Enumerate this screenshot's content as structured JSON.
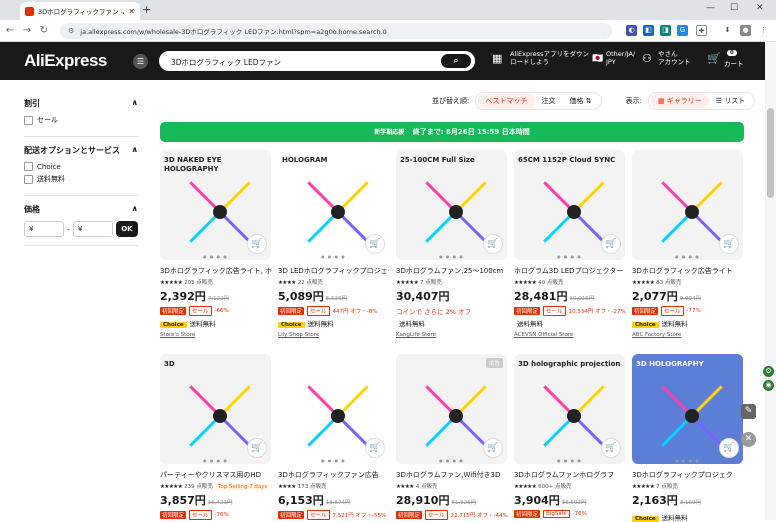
{
  "browser": {
    "tab_title": "3Dホログラフィックファン -AliEx",
    "url": "ja.aliexpress.com/w/wholesale-3Dホログラフィック LEDファン.html?spm=a2g0o.home.search.0"
  },
  "header": {
    "logo": "AliExpress",
    "search_value": "3Dホログラフィック LEDファン",
    "app_line1": "AliExpressアプリをダウン",
    "app_line2": "ロードしよう",
    "lang_line1": "Other/JA/",
    "lang_line2": "JPY",
    "account_line1": "やさん",
    "account_line2": "アカウント",
    "cart_label": "カート",
    "cart_count": "0"
  },
  "sidebar": {
    "discount_title": "割引",
    "sale_label": "セール",
    "delivery_title": "配送オプションとサービス",
    "choice_label": "Choice",
    "free_shipping_label": "送料無料",
    "price_title": "価格",
    "min_placeholder": "¥",
    "max_placeholder": "¥",
    "ok_label": "OK"
  },
  "sortbar": {
    "label": "並び替え順:",
    "options": [
      "ベストマッチ",
      "注文",
      "価格"
    ],
    "view_label": "表示:",
    "gallery": "ギャラリー",
    "list": "リスト"
  },
  "banner": {
    "tag": "新学期応援",
    "text": "終了まで: 8月26日 15:59 日本時間"
  },
  "products": [
    {
      "title": "3Dホログラフィック広告ライト, ホログラフ",
      "stars": "★★★★★",
      "rating_text": "205 点販売",
      "price": "2,392円",
      "old": "7,122円",
      "badge": "初回限定",
      "sale": "セール",
      "extra": "-66%",
      "choice": "Choice",
      "ship": "送料無料",
      "store": "Store's Store",
      "img_text": "3D NAKED EYE HOLOGRAPHY",
      "img_kind": "white",
      "color": "#ffffff"
    },
    {
      "title": "3D LEDホログラフィックプロジェクター",
      "stars": "★★★★",
      "rating_text": "22 点販売",
      "price": "5,089円",
      "old": "5,536円",
      "badge": "初回限定",
      "sale": "セール",
      "extra": "447円 オフ・-8%",
      "choice": "Choice",
      "ship": "送料無料",
      "store": "Lily Shop Store",
      "img_text": "HOLOGRAM",
      "img_kind": "dark",
      "color": "#ffffff"
    },
    {
      "title": "3Dホログラムファン,25〜100cm",
      "stars": "★★★★★",
      "rating_text": "7 点販売",
      "price": "30,407円",
      "old": "",
      "badge": "",
      "sale": "",
      "extra": "コインで さらに 2% オフ",
      "choice": "",
      "ship": "送料無料",
      "store": "KangLife Store",
      "img_text": "25-100CM Full Size",
      "img_kind": "white",
      "color": "#ffffff"
    },
    {
      "title": "ホログラム3D LEDプロジェクター",
      "stars": "★★★★★",
      "rating_text": "40 点販売",
      "price": "28,481円",
      "old": "39,015円",
      "badge": "初回限定",
      "sale": "セール",
      "extra": "10,534円 オフ・-27%",
      "choice": "",
      "ship": "送料無料",
      "store": "ACEVSN Official Store",
      "img_text": "65CM 1152P Cloud SYNC",
      "img_kind": "white",
      "color": "#ffffff"
    },
    {
      "title": "3Dホログラフィック広告ライト",
      "stars": "★★★★★",
      "rating_text": "83 点販売",
      "price": "2,077円",
      "old": "9,094円",
      "badge": "初回限定",
      "sale": "セール",
      "extra": "-77%",
      "choice": "Choice",
      "ship": "送料無料",
      "store": "ABC Factory Store",
      "img_text": "",
      "img_kind": "white",
      "color": "#ffffff"
    },
    {
      "title": "パーティーやクリスマス用のHD",
      "stars": "★★★★★",
      "rating_text": "239 点販売",
      "price": "3,857円",
      "old": "16,423円",
      "badge": "初回限定",
      "sale": "セール",
      "extra": "-76%",
      "choice": "",
      "ship": "",
      "store": "",
      "img_text": "3D",
      "img_kind": "white",
      "color": "#ffffff",
      "tag": "Top Selling 7 days"
    },
    {
      "title": "3Dホログラフィックファン広告",
      "stars": "★★★★",
      "rating_text": "173 点販売",
      "price": "6,153円",
      "old": "13,674円",
      "badge": "初回限定",
      "sale": "セール",
      "extra": "7,521円 オフ・-55%",
      "choice": "",
      "ship": "",
      "store": "",
      "img_text": "",
      "img_kind": "dark",
      "color": "#ffffff"
    },
    {
      "title": "3Dホログラムファン,Wifi付き3D",
      "stars": "★★★★",
      "rating_text": "4 点販売",
      "price": "28,910円",
      "old": "51,625円",
      "badge": "初回限定",
      "sale": "セール",
      "extra": "22,715円 オフ・-44%",
      "choice": "",
      "ship": "",
      "store": "",
      "img_text": "",
      "img_kind": "white",
      "color": "#ffffff",
      "ad": "広告"
    },
    {
      "title": "3Dホログラムファンホログラフ",
      "stars": "★★★★★",
      "rating_text": "600+ 点販売",
      "price": "3,904円",
      "old": "16,593円",
      "badge": "初回限定",
      "sale": "BigSale",
      "extra": "-76%",
      "choice": "",
      "ship": "",
      "store": "",
      "img_text": "3D holographic projection",
      "img_kind": "white",
      "color": "#ffffff"
    },
    {
      "title": "3Dホログラフィックプロジェク",
      "stars": "★★★★★",
      "rating_text": "7 点販売",
      "price": "2,163円",
      "old": "3,169円",
      "badge": "",
      "sale": "",
      "extra": "",
      "choice": "Choice",
      "ship": "送料無料",
      "store": "",
      "img_text": "3D HOLOGRAPHY",
      "img_kind": "blue",
      "color": "#ffffff"
    }
  ]
}
